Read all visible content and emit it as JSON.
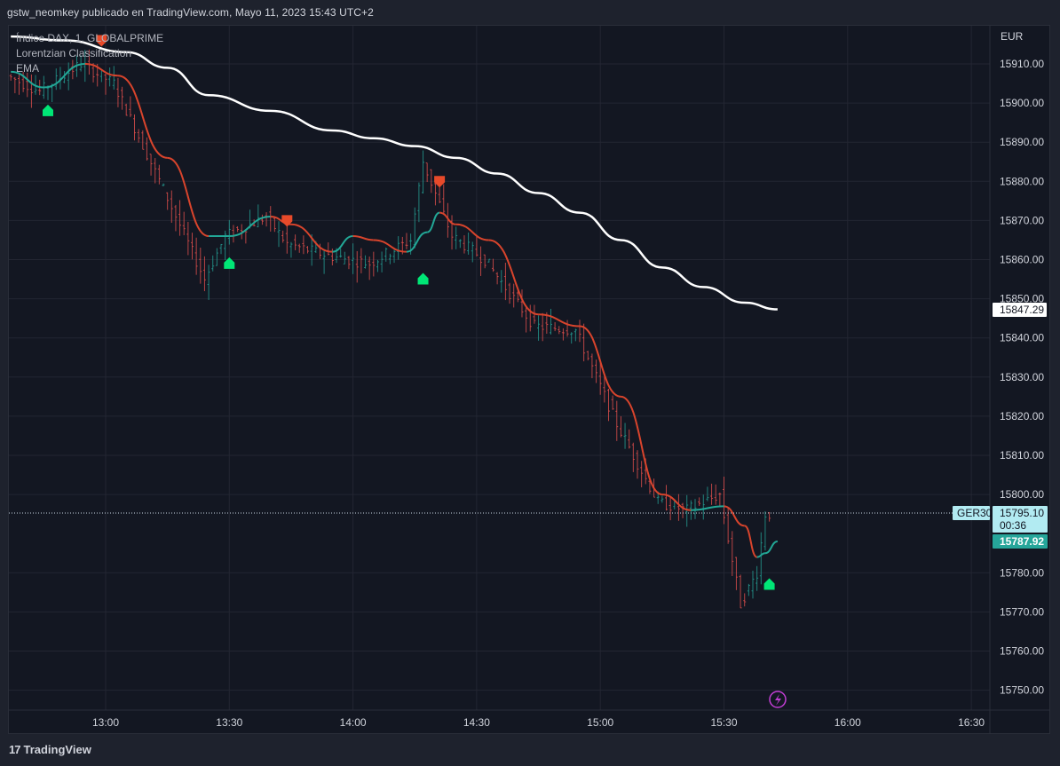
{
  "header": {
    "publish_info": "gstw_neomkey publicado en TradingView.com, Mayo 11, 2023 15:43 UTC+2"
  },
  "legend": {
    "symbol_line": "Índice DAX, 1, GLOBALPRIME",
    "indicator_1": "Lorentzian Classification",
    "indicator_2": "EMA"
  },
  "footer": {
    "brand_logo": "17",
    "brand_name": "TradingView"
  },
  "colors": {
    "background": "#131722",
    "grid": "#232632",
    "bull_candle": "#26a69a",
    "bear_candle": "#ef5350",
    "kernel_bull": "#22a897",
    "kernel_bear": "#d8442c",
    "ema": "#ffffff",
    "buy_marker": "#00e676",
    "sell_marker": "#e84a2a",
    "last_price_tag": "#26a69a"
  },
  "chart_data": {
    "type": "candlestick",
    "symbol": "Índice DAX, 1, GLOBALPRIME",
    "timeframe": "1",
    "currency": "EUR",
    "y_ticks": [
      15910,
      15900,
      15890,
      15880,
      15870,
      15860,
      15850,
      15840,
      15830,
      15820,
      15810,
      15800,
      15780,
      15770,
      15760,
      15750
    ],
    "y_tick_labels": [
      "15910.00",
      "15900.00",
      "15890.00",
      "15880.00",
      "15870.00",
      "15860.00",
      "15850.00",
      "15840.00",
      "15830.00",
      "15820.00",
      "15810.00",
      "15800.00",
      "15780.00",
      "15770.00",
      "15760.00",
      "15750.00"
    ],
    "ylim": [
      15746,
      15920
    ],
    "x_ticks": [
      "13:00",
      "13:30",
      "14:00",
      "14:30",
      "15:00",
      "15:30",
      "16:00",
      "16:30"
    ],
    "x_range_minutes": [
      "12:37",
      "16:40"
    ],
    "price_path": [
      {
        "t": "12:37",
        "p": 15907
      },
      {
        "t": "12:45",
        "p": 15903
      },
      {
        "t": "12:55",
        "p": 15910
      },
      {
        "t": "13:03",
        "p": 15905
      },
      {
        "t": "13:15",
        "p": 15878
      },
      {
        "t": "13:25",
        "p": 15855
      },
      {
        "t": "13:30",
        "p": 15866
      },
      {
        "t": "13:40",
        "p": 15871
      },
      {
        "t": "13:45",
        "p": 15864
      },
      {
        "t": "13:55",
        "p": 15861
      },
      {
        "t": "14:05",
        "p": 15859
      },
      {
        "t": "14:15",
        "p": 15865
      },
      {
        "t": "14:18",
        "p": 15885
      },
      {
        "t": "14:25",
        "p": 15866
      },
      {
        "t": "14:33",
        "p": 15860
      },
      {
        "t": "14:45",
        "p": 15843
      },
      {
        "t": "14:55",
        "p": 15842
      },
      {
        "t": "15:05",
        "p": 15818
      },
      {
        "t": "15:15",
        "p": 15798
      },
      {
        "t": "15:22",
        "p": 15796
      },
      {
        "t": "15:30",
        "p": 15800
      },
      {
        "t": "15:35",
        "p": 15772
      },
      {
        "t": "15:39",
        "p": 15780
      },
      {
        "t": "15:41",
        "p": 15795
      }
    ],
    "series": [
      {
        "name": "EMA",
        "points": [
          {
            "t": "12:37",
            "p": 15917
          },
          {
            "t": "12:50",
            "p": 15916
          },
          {
            "t": "13:05",
            "p": 15913
          },
          {
            "t": "13:15",
            "p": 15909
          },
          {
            "t": "13:25",
            "p": 15902
          },
          {
            "t": "13:40",
            "p": 15898
          },
          {
            "t": "13:55",
            "p": 15893
          },
          {
            "t": "14:05",
            "p": 15891
          },
          {
            "t": "14:15",
            "p": 15889
          },
          {
            "t": "14:25",
            "p": 15886
          },
          {
            "t": "14:35",
            "p": 15882
          },
          {
            "t": "14:45",
            "p": 15877
          },
          {
            "t": "14:55",
            "p": 15872
          },
          {
            "t": "15:05",
            "p": 15865
          },
          {
            "t": "15:15",
            "p": 15858
          },
          {
            "t": "15:25",
            "p": 15853
          },
          {
            "t": "15:35",
            "p": 15849
          },
          {
            "t": "15:43",
            "p": 15847.29
          }
        ]
      },
      {
        "name": "Lorentzian Classification",
        "points": [
          {
            "t": "12:37",
            "p": 15908
          },
          {
            "t": "12:45",
            "p": 15904,
            "c": "bull"
          },
          {
            "t": "12:55",
            "p": 15910,
            "c": "bull"
          },
          {
            "t": "13:03",
            "p": 15907,
            "c": "bear"
          },
          {
            "t": "13:15",
            "p": 15886,
            "c": "bear"
          },
          {
            "t": "13:25",
            "p": 15866,
            "c": "bear"
          },
          {
            "t": "13:30",
            "p": 15866,
            "c": "bull"
          },
          {
            "t": "13:40",
            "p": 15871,
            "c": "bull"
          },
          {
            "t": "13:45",
            "p": 15869,
            "c": "bear"
          },
          {
            "t": "13:55",
            "p": 15862,
            "c": "bear"
          },
          {
            "t": "14:00",
            "p": 15866,
            "c": "bull"
          },
          {
            "t": "14:05",
            "p": 15865,
            "c": "bear"
          },
          {
            "t": "14:13",
            "p": 15862,
            "c": "bear"
          },
          {
            "t": "14:18",
            "p": 15867,
            "c": "bull"
          },
          {
            "t": "14:21",
            "p": 15872,
            "c": "bull"
          },
          {
            "t": "14:25",
            "p": 15869,
            "c": "bear"
          },
          {
            "t": "14:33",
            "p": 15865,
            "c": "bear"
          },
          {
            "t": "14:45",
            "p": 15846,
            "c": "bear"
          },
          {
            "t": "14:55",
            "p": 15843,
            "c": "bear"
          },
          {
            "t": "15:05",
            "p": 15825,
            "c": "bear"
          },
          {
            "t": "15:15",
            "p": 15800,
            "c": "bear"
          },
          {
            "t": "15:22",
            "p": 15796,
            "c": "bear"
          },
          {
            "t": "15:30",
            "p": 15797,
            "c": "bull"
          },
          {
            "t": "15:35",
            "p": 15792,
            "c": "bear"
          },
          {
            "t": "15:38",
            "p": 15784,
            "c": "bear"
          },
          {
            "t": "15:40",
            "p": 15785,
            "c": "bull"
          },
          {
            "t": "15:43",
            "p": 15788,
            "c": "bull"
          }
        ]
      }
    ],
    "buy_signals": [
      {
        "t": "12:46",
        "p": 15898
      },
      {
        "t": "13:30",
        "p": 15859
      },
      {
        "t": "14:17",
        "p": 15855
      },
      {
        "t": "15:41",
        "p": 15777
      }
    ],
    "sell_signals": [
      {
        "t": "12:59",
        "p": 15916
      },
      {
        "t": "13:44",
        "p": 15870
      },
      {
        "t": "14:21",
        "p": 15880
      }
    ],
    "price_labels": {
      "currency_label": "EUR",
      "ema_value": "15847.29",
      "symbol_tag": "GER30",
      "last_price": "15795.10",
      "countdown": "00:36",
      "kernel_value": "15787.92"
    }
  }
}
